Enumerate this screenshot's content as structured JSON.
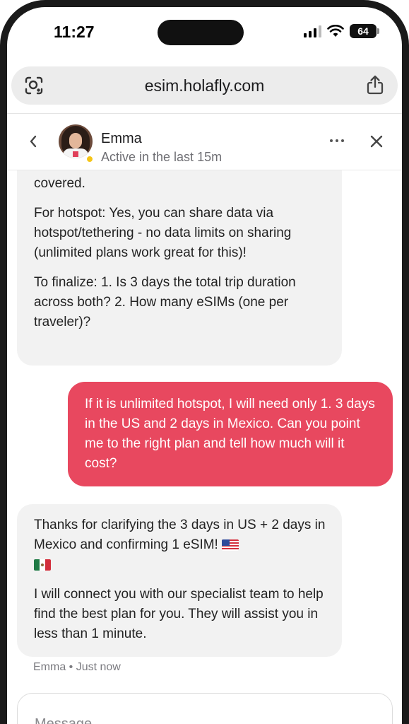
{
  "status_bar": {
    "time": "11:27",
    "battery": "64"
  },
  "browser": {
    "url": "esim.holafly.com"
  },
  "chat_header": {
    "name": "Emma",
    "status": "Active in the last 15m"
  },
  "messages": [
    {
      "sender": "agent",
      "paragraphs": [
        "covered.",
        "For hotspot: Yes, you can share data via hotspot/tethering - no data limits on sharing (unlimited plans work great for this)!",
        "To finalize: 1. Is 3 days the total trip duration across both? 2. How many eSIMs (one per traveler)?"
      ]
    },
    {
      "sender": "user",
      "text": "If it is unlimited hotspot, I will need only 1. 3 days in the US and 2 days in Mexico. Can you point me to the right plan and tell how much will it cost?"
    },
    {
      "sender": "agent",
      "paragraphs": [
        "Thanks for clarifying the 3 days in US + 2 days in Mexico and confirming 1 eSIM!",
        "I will connect you with our specialist team to help find the best plan for you. They will assist you in less than 1 minute."
      ],
      "flags": [
        "us-flag",
        "mexico-flag"
      ],
      "meta": "Emma • Just now"
    }
  ],
  "composer": {
    "placeholder": "Message..."
  },
  "colors": {
    "user_bubble": "#e8485f",
    "agent_bubble": "#f2f2f2",
    "presence": "#f5c518"
  }
}
